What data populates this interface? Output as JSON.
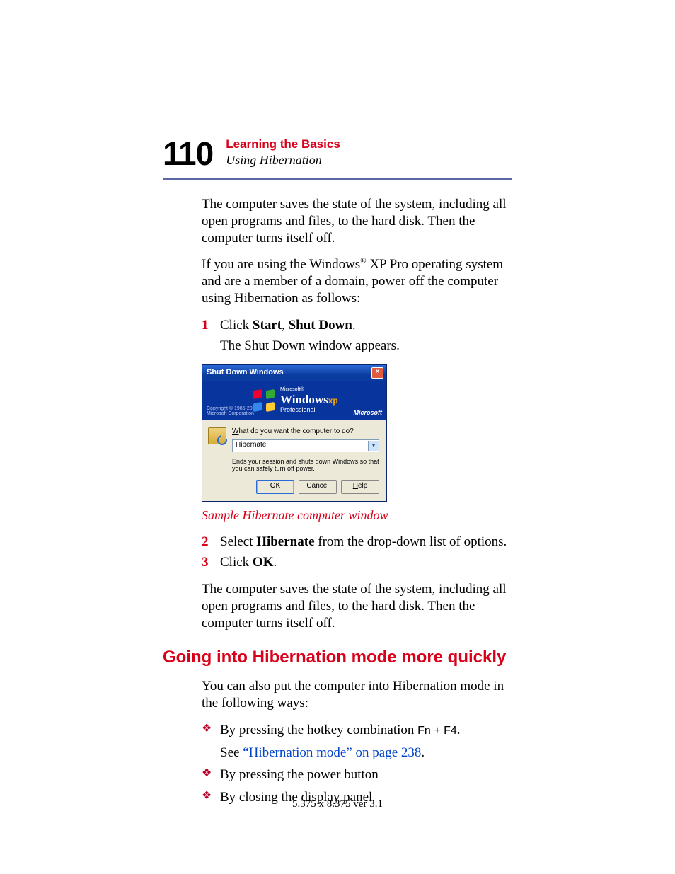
{
  "header": {
    "page_number": "110",
    "chapter": "Learning the Basics",
    "subchapter": "Using Hibernation"
  },
  "body": {
    "p1": "The computer saves the state of the system, including all open programs and files, to the hard disk. Then the computer turns itself off.",
    "p2_a": "If you are using the Windows",
    "p2_reg": "®",
    "p2_b": " XP Pro operating system and are a member of a domain, power off the computer using Hibernation as follows:",
    "step1_num": "1",
    "step1_a": "Click ",
    "step1_b1": "Start",
    "step1_c": ", ",
    "step1_b2": "Shut Down",
    "step1_d": ".",
    "step1_sub": "The Shut Down window appears.",
    "caption": "Sample Hibernate computer window",
    "step2_num": "2",
    "step2_a": "Select ",
    "step2_b": "Hibernate",
    "step2_c": " from the drop-down list of options.",
    "step3_num": "3",
    "step3_a": "Click ",
    "step3_b": "OK",
    "step3_c": ".",
    "p3": "The computer saves the state of the system, including all open programs and files, to the hard disk. Then the computer turns itself off.",
    "h2": "Going into Hibernation mode more quickly",
    "p4": "You can also put the computer into Hibernation mode in the following ways:",
    "bul1_a": "By pressing the hotkey combination ",
    "bul1_key": "Fn + F4",
    "bul1_b": ".",
    "bul1_sub_a": "See ",
    "bul1_sub_link": "“Hibernation mode” on page 238",
    "bul1_sub_b": ".",
    "bul2": "By pressing the power button",
    "bul3": "By closing the display panel"
  },
  "dialog": {
    "title": "Shut Down Windows",
    "copyright_l1": "Copyright © 1985-2001",
    "copyright_l2": "Microsoft Corporation",
    "brand_ms": "Microsoft®",
    "brand_win": "Windows",
    "brand_xp": "xp",
    "brand_pro": "Professional",
    "brand_ms2": "Microsoft",
    "question_u": "W",
    "question_rest": "hat do you want the computer to do?",
    "select_value": "Hibernate",
    "desc": "Ends your session and shuts down Windows so that you can safely turn off power.",
    "btn_ok": "OK",
    "btn_cancel": "Cancel",
    "btn_help_u": "H",
    "btn_help_rest": "elp"
  },
  "footer": "5.375 x 8.375 ver 3.1"
}
